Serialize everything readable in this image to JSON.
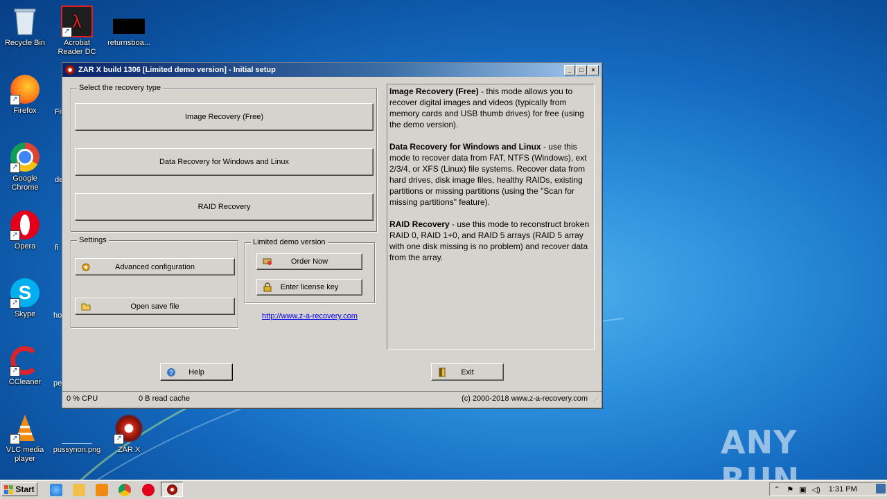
{
  "desktop": {
    "icons": [
      {
        "label": "Recycle Bin"
      },
      {
        "label": "Acrobat Reader DC"
      },
      {
        "label": "returnsboa..."
      },
      {
        "label": "Firefox"
      },
      {
        "label": "Google Chrome"
      },
      {
        "label": "Opera"
      },
      {
        "label": "Skype"
      },
      {
        "label": "CCleaner"
      },
      {
        "label": "VLC media player"
      },
      {
        "label": "pussynon.png"
      },
      {
        "label": "ZAR X"
      }
    ],
    "peek_labels": [
      "Fil",
      "de",
      "fi",
      "ho",
      "pe"
    ],
    "watermark": "ANY RUN"
  },
  "window": {
    "title": "ZAR X build 1306 [Limited demo version] - Initial setup",
    "recovery_group": {
      "label": "Select the recovery type",
      "buttons": [
        "Image Recovery (Free)",
        "Data Recovery for Windows and Linux",
        "RAID Recovery"
      ]
    },
    "settings_group": {
      "label": "Settings",
      "advanced": "Advanced configuration",
      "open_save": "Open save file"
    },
    "demo_group": {
      "label": "Limited demo version",
      "order": "Order Now",
      "license": "Enter license key",
      "link": "http://www.z-a-recovery.com"
    },
    "description": [
      {
        "title": "Image Recovery (Free)",
        "text": " - this mode allows you to recover digital images and videos (typically from memory cards and USB thumb drives) for free (using the demo version)."
      },
      {
        "title": "Data Recovery for Windows and Linux",
        "text": " - use this mode to recover data from FAT, NTFS (Windows), ext 2/3/4, or XFS (Linux) file systems. Recover data from hard drives, disk image files, healthy RAIDs, existing partitions or missing partitions (using the \"Scan for missing partitions\" feature)."
      },
      {
        "title": "RAID Recovery",
        "text": " - use this mode to reconstruct broken RAID 0, RAID 1+0, and RAID 5 arrays (RAID 5 array with one disk missing is no problem) and recover data from the array."
      }
    ],
    "help_button": "Help",
    "exit_button": "Exit",
    "status": {
      "cpu": "0 % CPU",
      "cache": "0 B read cache",
      "copyright": "(c) 2000-2018 www.z-a-recovery.com"
    }
  },
  "taskbar": {
    "start": "Start",
    "clock": "1:31 PM"
  }
}
